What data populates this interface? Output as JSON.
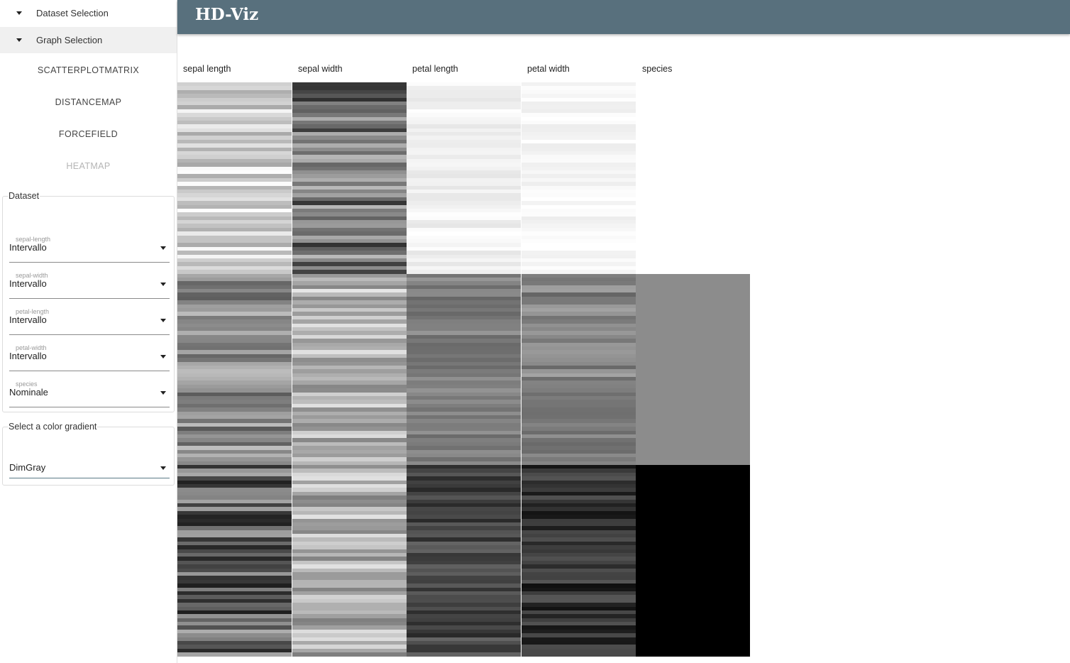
{
  "header": {
    "title": "HD-Viz"
  },
  "sidebar": {
    "accordion": [
      {
        "label": "Dataset Selection",
        "active": false
      },
      {
        "label": "Graph Selection",
        "active": true
      }
    ],
    "graphs": [
      {
        "label": "SCATTERPLOTMATRIX",
        "disabled": false
      },
      {
        "label": "DISTANCEMAP",
        "disabled": false
      },
      {
        "label": "FORCEFIELD",
        "disabled": false
      },
      {
        "label": "HEATMAP",
        "disabled": true
      }
    ],
    "dataset": {
      "legend": "Dataset",
      "fields": [
        {
          "label": "sepal-length",
          "value": "Intervallo"
        },
        {
          "label": "sepal-width",
          "value": "Intervallo"
        },
        {
          "label": "petal-length",
          "value": "Intervallo"
        },
        {
          "label": "petal-width",
          "value": "Intervallo"
        },
        {
          "label": "species",
          "value": "Nominale"
        }
      ]
    },
    "gradient": {
      "legend": "Select a color gradient",
      "value": "DimGray"
    }
  },
  "chart_data": {
    "type": "heatmap",
    "columns": [
      "sepal length",
      "sepal width",
      "petal length",
      "petal width",
      "species"
    ],
    "row_groups": [
      {
        "rows": 50,
        "column_brightness": [
          0.82,
          0.45,
          0.95,
          0.97,
          1.0
        ],
        "column_variation": [
          0.18,
          0.28,
          0.05,
          0.04,
          0.0
        ]
      },
      {
        "rows": 50,
        "column_brightness": [
          0.55,
          0.72,
          0.5,
          0.52,
          0.55
        ],
        "column_variation": [
          0.2,
          0.2,
          0.1,
          0.12,
          0.0
        ]
      },
      {
        "rows": 50,
        "column_brightness": [
          0.42,
          0.68,
          0.28,
          0.2,
          0.0
        ],
        "column_variation": [
          0.3,
          0.22,
          0.12,
          0.14,
          0.0
        ]
      }
    ],
    "color_gradient": [
      "#000000",
      "#ffffff"
    ]
  }
}
